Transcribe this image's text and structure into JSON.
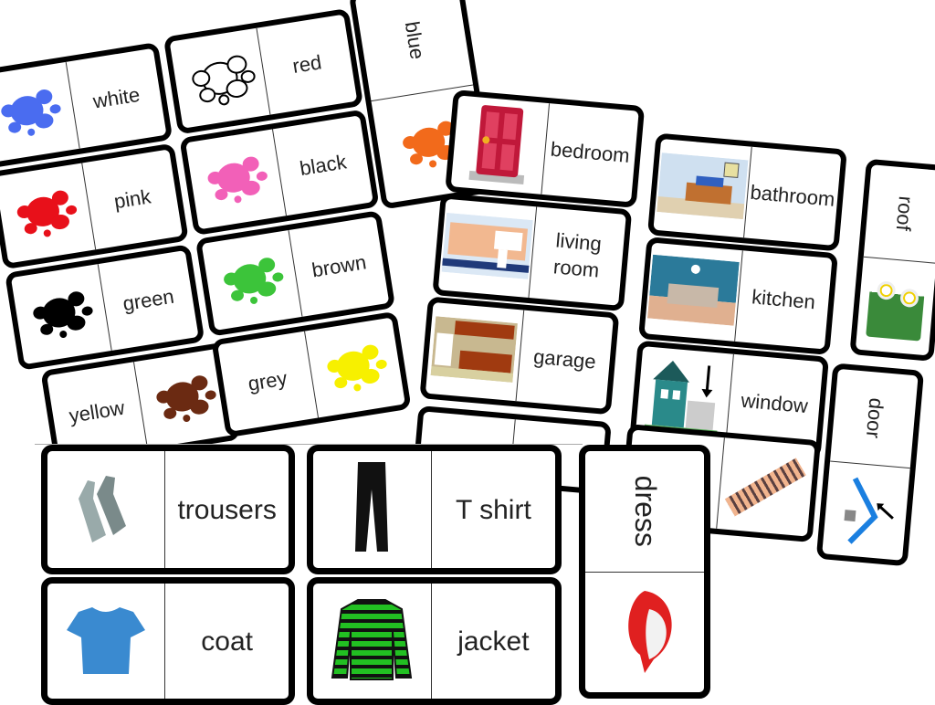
{
  "colors_sheet": {
    "cards": [
      {
        "image": "splat-icon",
        "image_color": "#4a6cf0",
        "word": "white"
      },
      {
        "image": "splat-outline-icon",
        "image_color": "#ffffff",
        "word": "red"
      },
      {
        "image": "splat-icon",
        "image_color": "#e8101a",
        "word": "pink"
      },
      {
        "image": "splat-icon",
        "image_color": "#f260b8",
        "word": "black"
      },
      {
        "image": "splat-icon",
        "image_color": "#000000",
        "word": "green"
      },
      {
        "image": "splat-icon",
        "image_color": "#3cc43a",
        "word": "brown"
      },
      {
        "image": "splat-icon",
        "image_color": "#6b2a12",
        "word": "yellow"
      },
      {
        "image": "splat-icon",
        "image_color": "#f7f000",
        "word": "grey"
      }
    ],
    "vertical_card": {
      "word": "blue",
      "image": "splat-icon",
      "image_color": "#f26a1b"
    }
  },
  "rooms_sheet": {
    "cards": [
      {
        "image": "door-icon",
        "word": "bedroom"
      },
      {
        "image": "bathroom-scene-icon",
        "word": "bathroom"
      },
      {
        "image": "bathroom-sink-scene-icon",
        "word": "living room"
      },
      {
        "image": "living-room-scene-icon",
        "word": "kitchen"
      },
      {
        "image": "kitchen-scene-icon",
        "word": "garage"
      },
      {
        "image": "house-icon",
        "word": "window"
      }
    ],
    "vertical_cards": [
      {
        "word": "roof",
        "image": "grass-flowers-icon"
      },
      {
        "word": "door",
        "image": "roof-arrow-icon"
      }
    ]
  },
  "clothes_sheet": {
    "cards": [
      {
        "image": "gloves-icon",
        "word": "trousers"
      },
      {
        "image": "trousers-icon",
        "word": "T shirt"
      },
      {
        "image": "tshirt-icon",
        "word": "coat"
      },
      {
        "image": "jacket-icon",
        "word": "jacket"
      }
    ],
    "vertical_card": {
      "word": "dress",
      "image": "cap-icon"
    }
  }
}
